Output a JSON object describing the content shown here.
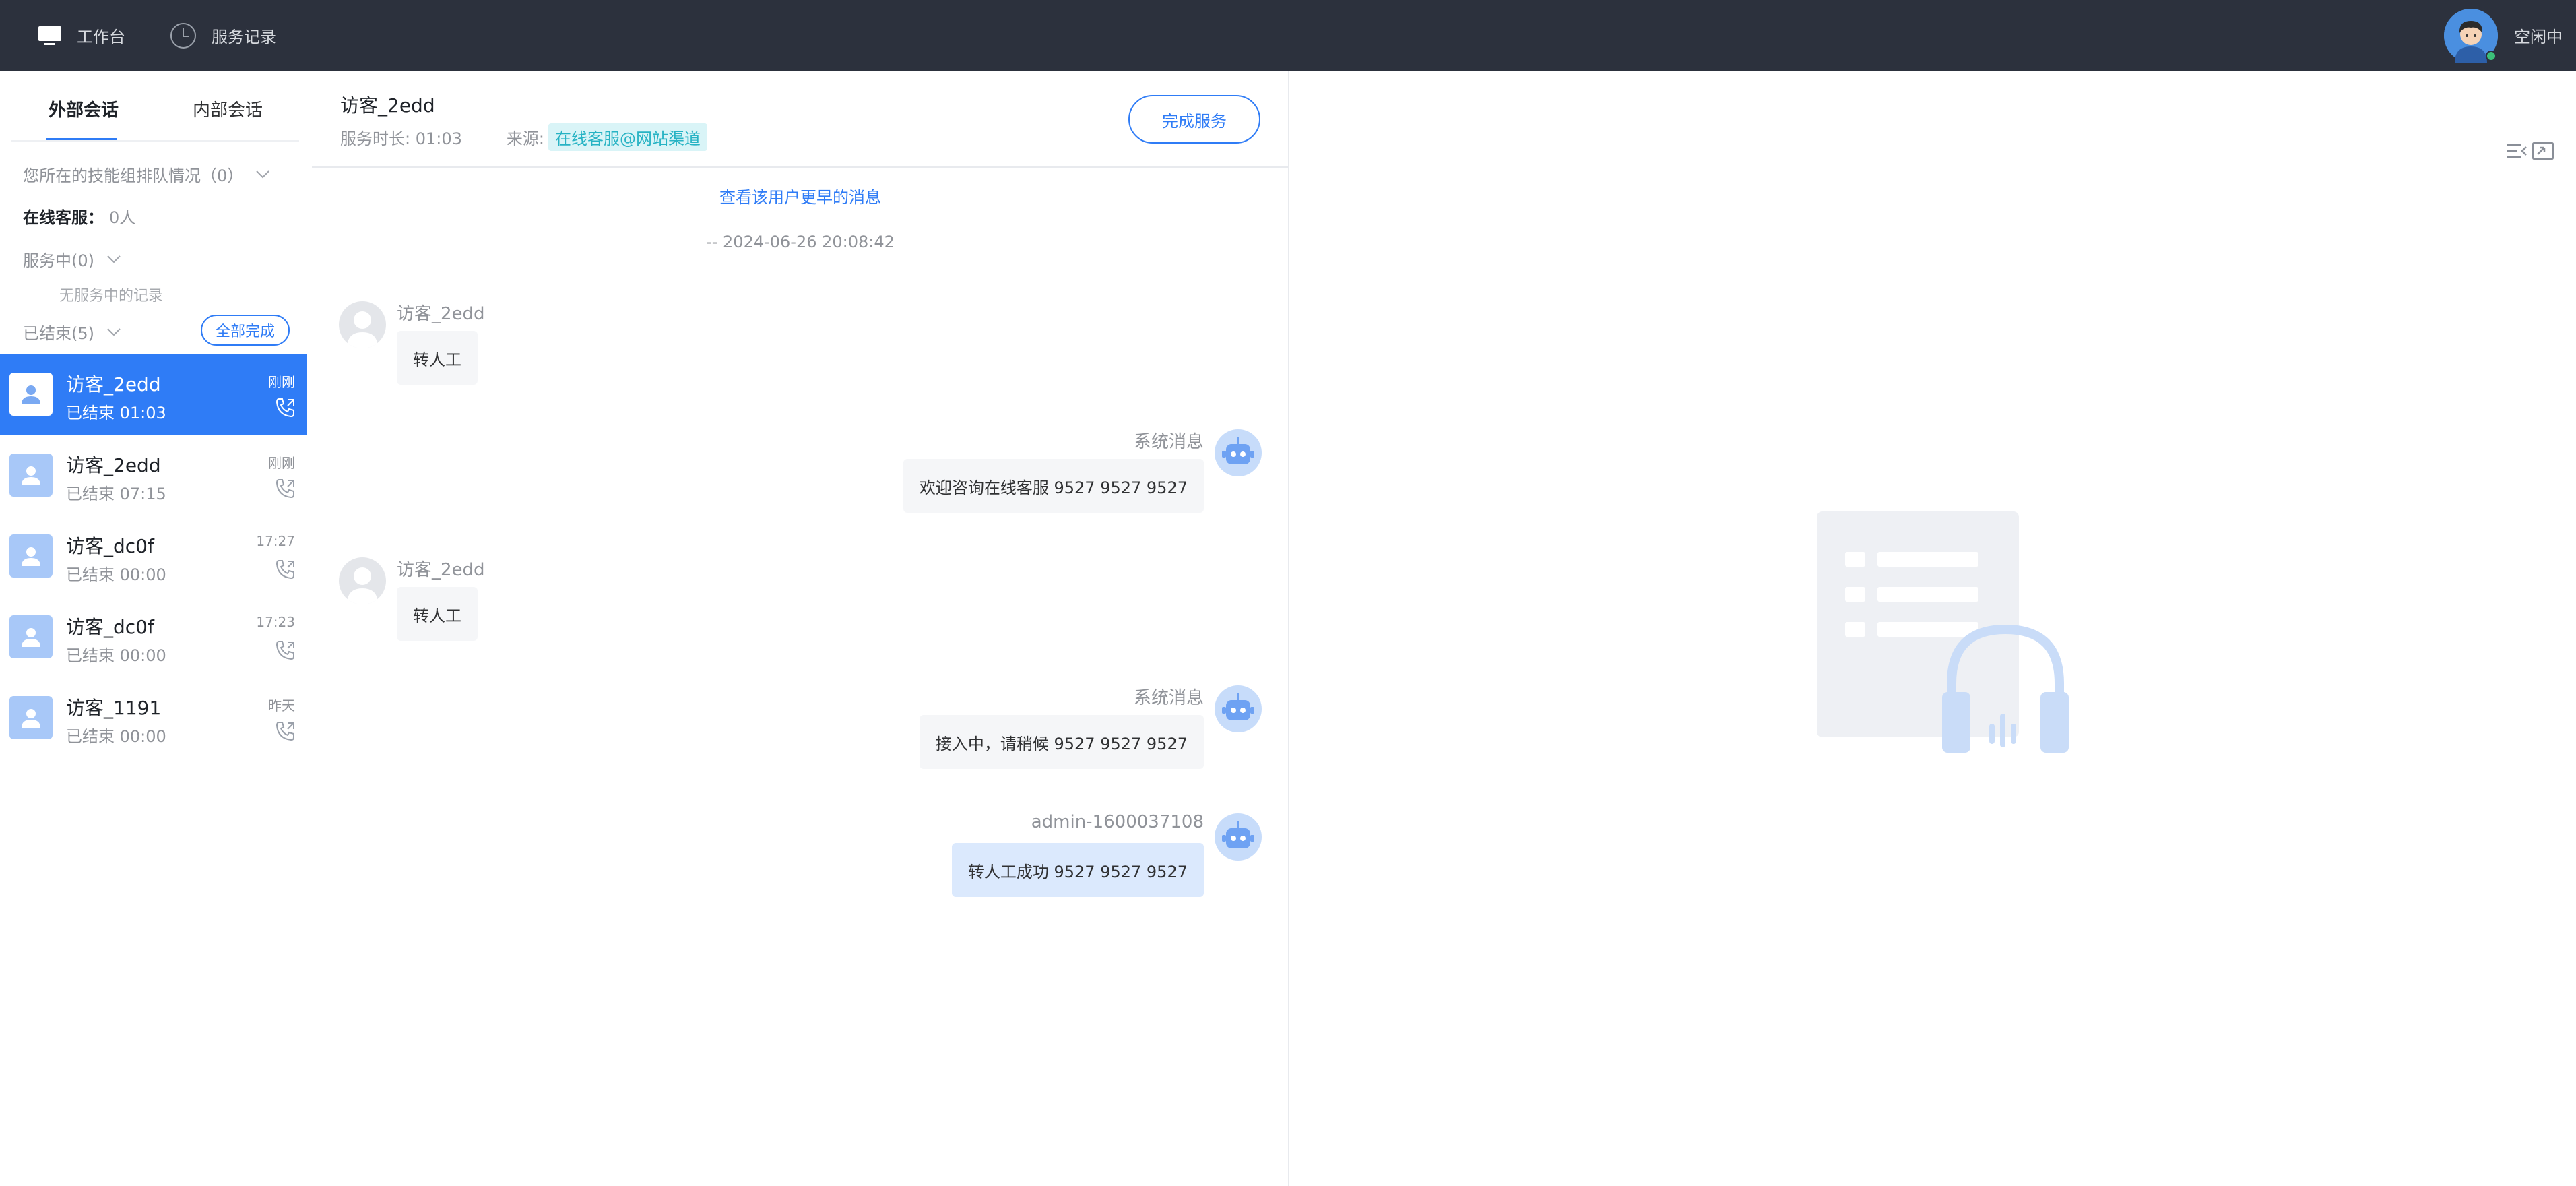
{
  "topbar": {
    "workbench_label": "工作台",
    "records_label": "服务记录",
    "status_label": "空闲中",
    "status_dot_color": "#3cc079"
  },
  "left": {
    "tabs": [
      {
        "label": "外部会话",
        "active": true
      },
      {
        "label": "内部会话",
        "active": false
      }
    ],
    "queue_text": "您所在的技能组排队情况（0）",
    "online_label": "在线客服：",
    "online_value": "0人",
    "serving_label": "服务中(0)",
    "no_serving_text": "无服务中的记录",
    "ended_label": "已结束(5)",
    "complete_all_label": "全部完成",
    "conversations": [
      {
        "name": "访客_2edd",
        "status": "已结束 01:03",
        "time": "刚刚",
        "active": true
      },
      {
        "name": "访客_2edd",
        "status": "已结束 07:15",
        "time": "刚刚",
        "active": false
      },
      {
        "name": "访客_dc0f",
        "status": "已结束 00:00",
        "time": "17:27",
        "active": false
      },
      {
        "name": "访客_dc0f",
        "status": "已结束 00:00",
        "time": "17:23",
        "active": false
      },
      {
        "name": "访客_1191",
        "status": "已结束 00:00",
        "time": "昨天",
        "active": false
      }
    ]
  },
  "chat": {
    "title": "访客_2edd",
    "duration": "服务时长: 01:03",
    "source_label": "来源:",
    "source_value": "在线客服@网站渠道",
    "finish_label": "完成服务",
    "older_link": "查看该用户更早的消息",
    "date_separator": "-- 2024-06-26 20:08:42",
    "messages": [
      {
        "side": "left",
        "sender": "访客_2edd",
        "text": "转人工"
      },
      {
        "side": "right",
        "sender": "系统消息",
        "text": "欢迎咨询在线客服 9527 9527 9527"
      },
      {
        "side": "left",
        "sender": "访客_2edd",
        "text": "转人工"
      },
      {
        "side": "right",
        "sender": "系统消息",
        "text": "接入中，请稍候 9527 9527 9527"
      },
      {
        "side": "right",
        "sender": "admin-1600037108",
        "text": "转人工成功 9527 9527 9527"
      }
    ]
  },
  "colors": {
    "accent": "#2f7cf6",
    "topbar_bg": "#2c313d",
    "source_badge_bg": "#d9f4f7",
    "source_badge_text": "#27b3c4"
  }
}
